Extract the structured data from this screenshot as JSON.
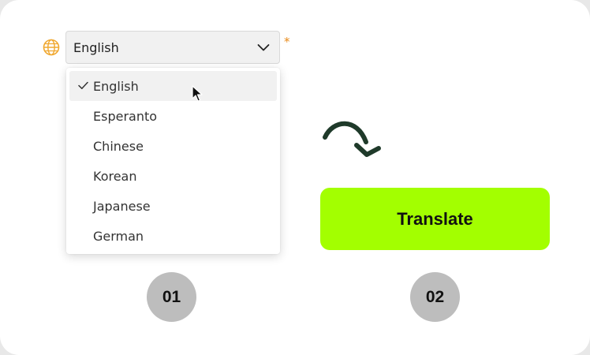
{
  "language_select": {
    "value": "English",
    "required_mark": "*",
    "icons": {
      "leading": "globe-icon",
      "trailing": "chevron-down-icon",
      "selected": "check-icon"
    },
    "options": [
      "English",
      "Esperanto",
      "Chinese",
      "Korean",
      "Japanese",
      "German"
    ],
    "selected_index": 0
  },
  "translate_button": {
    "label": "Translate"
  },
  "steps": [
    "01",
    "02"
  ],
  "colors": {
    "accent": "#a3ff00",
    "required": "#e88a1a",
    "arrow": "#1f3a2a",
    "step_badge": "#bdbdbd",
    "globe": "#f0a830"
  }
}
